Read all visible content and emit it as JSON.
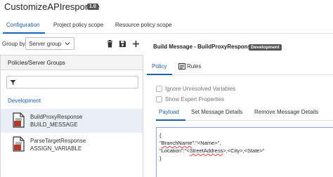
{
  "header": {
    "title": "CustomizeAPIresponse",
    "version": "1.0"
  },
  "top_tabs": [
    "Configuration",
    "Project policy scope",
    "Resource policy scope"
  ],
  "group_by": {
    "label": "Group by",
    "selected": "Server group"
  },
  "toolbar_icons": [
    "trash-icon",
    "save-icon",
    "add-icon"
  ],
  "left_panel": {
    "header": "Policies/Server Groups",
    "filter_icon": "filter-icon",
    "group_name": "Development",
    "policies": [
      {
        "name": "BuildProxyResponse",
        "type": "BUILD_MESSAGE"
      },
      {
        "name": "ParseTargetResponse",
        "type": "ASSIGN_VARIABLE"
      }
    ]
  },
  "right_panel": {
    "title": "Build Message - BuildProxyResponse",
    "badge": "Development",
    "tabs": [
      "Policy",
      "Rules"
    ],
    "checkboxes": [
      "Ignore Unresolved Variables",
      "Show Expert Properties"
    ],
    "code_tabs": [
      "Payload",
      "Set Message Details",
      "Remove Message Details"
    ],
    "code": {
      "line1": "{",
      "line2_key": "BranchName",
      "line2_rest": ":\"<Name>\",",
      "line3_prefix": "\"Location\":\"<",
      "line3_word": "StreetAddress",
      "line3_rest": ">,<City>,<State>\"",
      "line4": "}"
    }
  },
  "colors": {
    "accent": "#1a63b8",
    "badge": "#555555",
    "selected_row": "#e9eef7"
  }
}
